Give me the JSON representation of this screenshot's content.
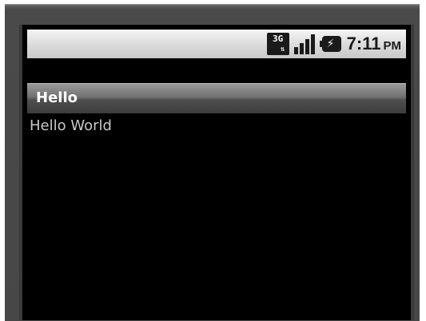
{
  "status_bar": {
    "network_label": "3G",
    "network_arrows": "⇅",
    "time": "7:11",
    "ampm": "PM",
    "icons": [
      "3g-data-icon",
      "signal-strength-icon",
      "battery-charging-icon"
    ]
  },
  "app": {
    "title": "Hello",
    "content_text": "Hello World"
  },
  "colors": {
    "screen_background": "#000000",
    "bezel": "#4a4a4a",
    "title_bar": "#5a5a5a",
    "content_text": "#c9c9c9"
  },
  "signal": {
    "bars_filled": 4,
    "bars_total": 4
  }
}
